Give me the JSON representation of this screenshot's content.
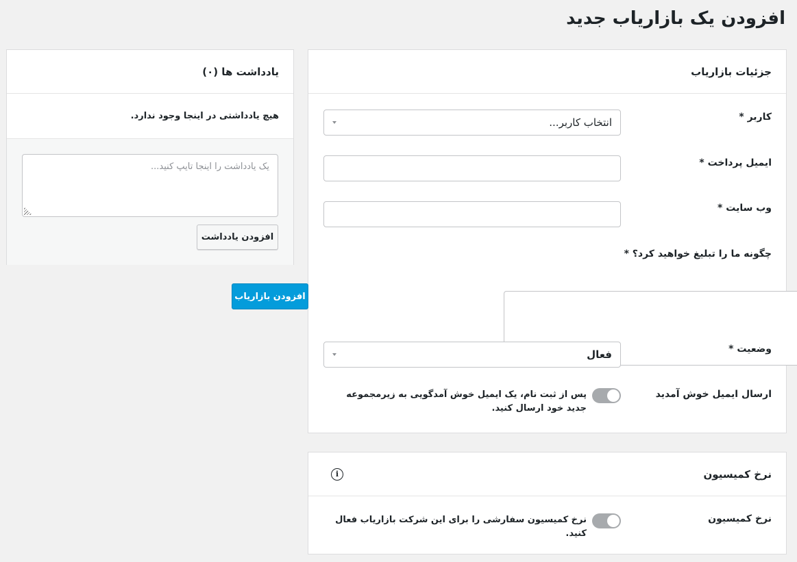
{
  "page": {
    "title": "افزودن یک بازاریاب جدید"
  },
  "details": {
    "title": "جزئیات بازاریاب",
    "user_label": "کاربر *",
    "user_placeholder": "انتخاب کاربر...",
    "payment_email_label": "ایمیل پرداخت *",
    "website_label": "وب سایت *",
    "promote_label": "چگونه ما را تبلیغ خواهید کرد؟ *",
    "status_label": "وضعیت *",
    "status_value": "فعال",
    "welcome_email_label": "ارسال ایمیل خوش آمدید",
    "welcome_email_text": "پس از ثبت نام، یک ایمیل خوش آمدگویی به زیرمجموعه جدید خود ارسال کنید."
  },
  "commission": {
    "title": "نرخ کمیسیون",
    "info_icon": "info-icon",
    "rate_label": "نرخ کمیسیون",
    "rate_text": "نرخ کمیسیون سفارشی را برای این شرکت بازاریاب فعال کنید."
  },
  "notes": {
    "title": "یادداشت ها (۰)",
    "empty_text": "هیچ یادداشتی در اینجا وجود ندارد.",
    "placeholder": "یک یادداشت را اینجا تایپ کنید...",
    "add_note_label": "افزودن یادداشت"
  },
  "actions": {
    "add_affiliate_label": "افزودن بازاریاب"
  },
  "colors": {
    "primary": "#049cdb",
    "toggle_off": "#a7aaad",
    "background": "#f1f1f1"
  }
}
